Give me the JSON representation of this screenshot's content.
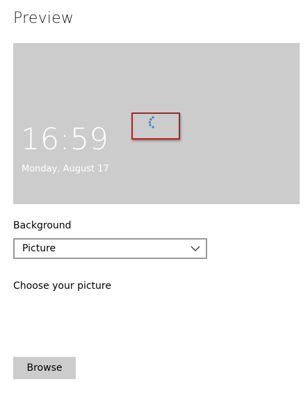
{
  "page": {
    "title": "Preview"
  },
  "preview": {
    "time": "16:59",
    "date": "Monday, August 17",
    "spinner_icon": "loading-spinner-icon",
    "highlight_color": "#b22222",
    "background_color": "#cccccc"
  },
  "background": {
    "label": "Background",
    "selected": "Picture",
    "dropdown_icon": "chevron-down-icon"
  },
  "choose_picture": {
    "label": "Choose your picture"
  },
  "browse_button": {
    "label": "Browse"
  }
}
